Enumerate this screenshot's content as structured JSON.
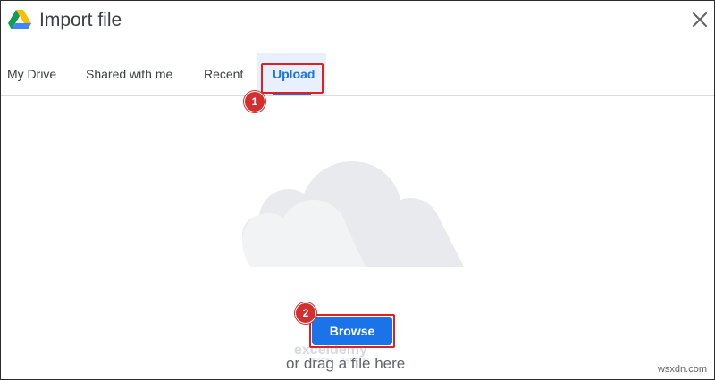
{
  "dialog": {
    "title": "Import file"
  },
  "tabs": [
    {
      "label": "My Drive"
    },
    {
      "label": "Shared with me"
    },
    {
      "label": "Recent"
    },
    {
      "label": "Upload",
      "active": true
    }
  ],
  "upload": {
    "browse_label": "Browse",
    "drag_text": "or drag a file here"
  },
  "annotations": {
    "step1": "1",
    "step2": "2"
  },
  "watermark": {
    "brand": "exceldemy",
    "tagline": "EXCEL · DATA · BI",
    "site": "wsxdn.com"
  },
  "colors": {
    "accent": "#1a73e8",
    "highlight_red": "#e02020",
    "badge_red": "#d32f2f",
    "cloud_gray": "#e8eaed"
  },
  "icons": [
    "google-drive-logo-icon",
    "close-icon",
    "cloud-illustration-icon"
  ]
}
